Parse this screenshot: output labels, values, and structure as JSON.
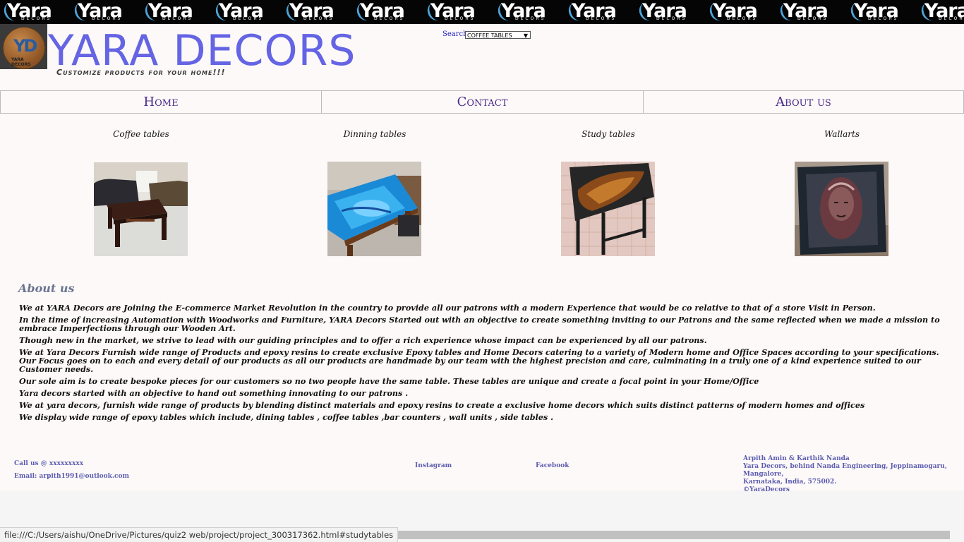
{
  "banner": {
    "brand_word": "Yara",
    "brand_sub": "DECORS",
    "tile_count": 14
  },
  "logo": {
    "initials": "YD",
    "label": "YARA DECORS"
  },
  "header": {
    "title": "YARA DECORS",
    "tagline": "Customize products for your home!!!",
    "search_label": "Search",
    "search_selected": "COFFEE TABLES"
  },
  "nav": [
    {
      "label": "Home"
    },
    {
      "label": "Contact"
    },
    {
      "label": "About us"
    }
  ],
  "products": [
    {
      "label": "Coffee tables"
    },
    {
      "label": "Dinning tables"
    },
    {
      "label": "Study tables"
    },
    {
      "label": "Wallarts"
    }
  ],
  "about": {
    "title": "About us",
    "paragraphs": [
      "We at YARA Decors are Joining the E-commerce Market Revolution in the country to provide all our patrons with a modern Experience that would be co relative to that of a store Visit in Person.",
      "In the time of increasing Automation with Woodworks and Furniture, YARA Decors Started out with an objective to create something inviting to our Patrons and the same reflected when we made a mission to embrace Imperfections through our Wooden Art.",
      "Though new in the market, we strive to lead with our guiding principles and to offer a rich experience whose impact can be experienced by all our patrons.",
      "We at Yara Decors Furnish wide range of Products and epoxy resins to create exclusive Epoxy tables and Home Decors catering to a variety of Modern home and Office Spaces according to your specifications. Our Focus goes on to each and every detail of our products as all our products are handmade by our team with the highest precision and care, culminating in a truly one of a kind experience suited to our Customer needs.",
      "Our sole aim is to create bespoke pieces for our customers so no two people have the same table. These tables are unique and create a focal point in your Home/Office",
      "Yara decors started with an objective to hand out something innovating to our patrons .",
      "We at yara decors, furnish wide range of products by blending distinct materials and epoxy resins to create a exclusive home decors which suits distinct patterns of modern homes and offices",
      "We display wide range of epoxy tables which include, dining tables , coffee tables ,bar counters , wall units , side tables ."
    ]
  },
  "footer": {
    "call": "Call us @ xxxxxxxxx",
    "email": "Email: arpith1991@outlook.com",
    "instagram": "Instagram",
    "facebook": "Facebook",
    "address": [
      "Arpith Amin & Karthik Nanda",
      "Yara Decors, behind Nanda Engineering, Jeppinamogaru, Mangalore,",
      "Karnataka, India, 575002.",
      "©YaraDecors"
    ]
  },
  "status_bar": {
    "url": "file:///C:/Users/aishu/OneDrive/Pictures/quiz2 web/project/project_300317362.html#studytables"
  }
}
